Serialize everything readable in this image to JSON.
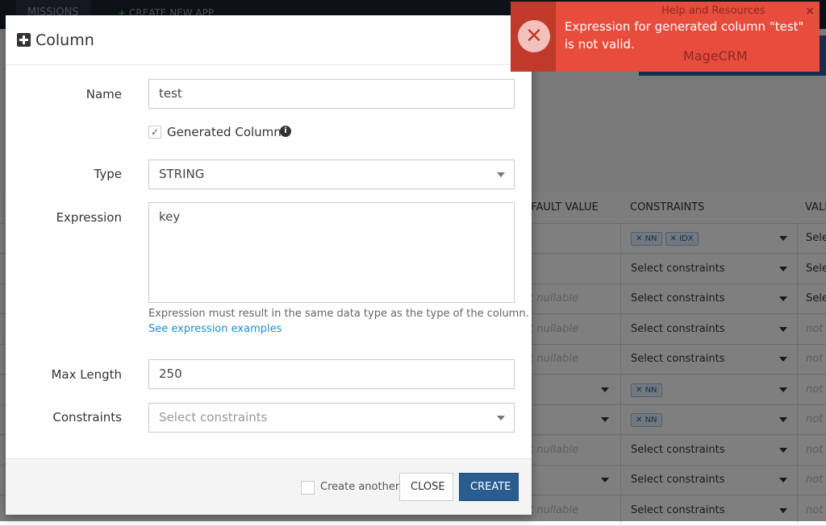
{
  "topbar": {
    "missions": "MISSIONS",
    "create_app": "CREATE NEW APP",
    "help": "Help and Resources",
    "app": "MageCRM"
  },
  "table": {
    "headers": {
      "default": "DEFAULT VALUE",
      "constraints": "CONSTRAINTS",
      "validation": "VALIDATION"
    },
    "rows": [
      {
        "def": "",
        "def_arrow": false,
        "tags": [
          "NN",
          "IDX"
        ],
        "con": "",
        "val": "Select"
      },
      {
        "def": "",
        "def_arrow": false,
        "tags": [],
        "con": "Select constraints",
        "val": "Select"
      },
      {
        "def": "not nullable",
        "def_arrow": false,
        "tags": [],
        "con": "Select constraints",
        "val": "Select"
      },
      {
        "def": "not nullable",
        "def_arrow": false,
        "tags": [],
        "con": "Select constraints",
        "val": "not"
      },
      {
        "def": "not nullable",
        "def_arrow": false,
        "tags": [],
        "con": "Select constraints",
        "val": "not"
      },
      {
        "def": "",
        "def_arrow": true,
        "tags": [
          "NN"
        ],
        "con": "",
        "val": "not"
      },
      {
        "def": "",
        "def_arrow": true,
        "tags": [
          "NN"
        ],
        "con": "",
        "val": "not"
      },
      {
        "def": "not nullable",
        "def_arrow": false,
        "tags": [],
        "con": "Select constraints",
        "val": "not"
      },
      {
        "def": "",
        "def_arrow": true,
        "tags": [],
        "con": "Select constraints",
        "val": "not"
      },
      {
        "def": "not nullable",
        "def_arrow": false,
        "tags": [],
        "con": "Select constraints",
        "val": "not"
      }
    ]
  },
  "modal": {
    "title": "Column",
    "name_label": "Name",
    "name_value": "test",
    "generated_label": "Generated Column",
    "generated_checked": true,
    "type_label": "Type",
    "type_value": "STRING",
    "expression_label": "Expression",
    "expression_value": "key",
    "expression_help": "Expression must result in the same data type as the type of the column.",
    "expression_link": "See expression examples",
    "maxlength_label": "Max Length",
    "maxlength_value": "250",
    "constraints_label": "Constraints",
    "constraints_placeholder": "Select constraints",
    "create_another": "Create another",
    "close": "CLOSE",
    "create": "CREATE"
  },
  "toast": {
    "message": "Expression for generated column \"test\" is not valid.",
    "close": "×",
    "icon": "x-circle-icon"
  }
}
